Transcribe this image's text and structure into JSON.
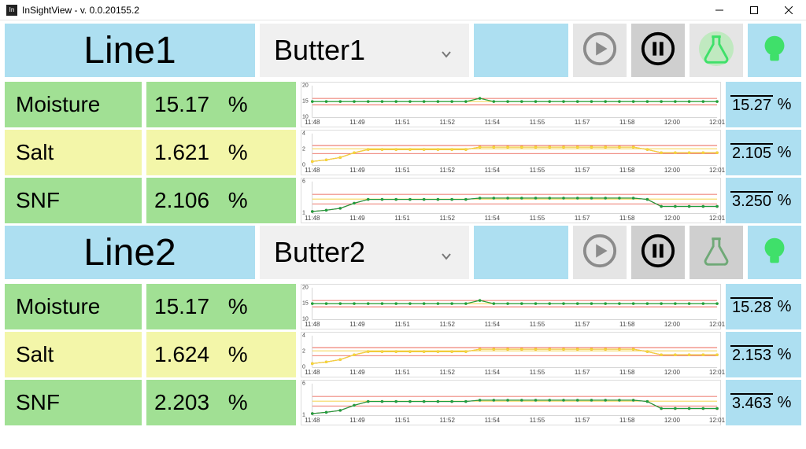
{
  "window": {
    "title": "InSightView - v. 0.0.20155.2",
    "icon_text": "In"
  },
  "lines": [
    {
      "title": "Line1",
      "recipe": "Butter1",
      "flask_glow": true,
      "params": [
        {
          "name": "Moisture",
          "value": "15.17",
          "unit": "%",
          "kind": "moist",
          "avg": "15.27",
          "chart": 0
        },
        {
          "name": "Salt",
          "value": "1.621",
          "unit": "%",
          "kind": "salt",
          "avg": "2.105",
          "chart": 1
        },
        {
          "name": "SNF",
          "value": "2.106",
          "unit": "%",
          "kind": "snf",
          "avg": "3.250",
          "chart": 2
        }
      ]
    },
    {
      "title": "Line2",
      "recipe": "Butter2",
      "flask_glow": false,
      "params": [
        {
          "name": "Moisture",
          "value": "15.17",
          "unit": "%",
          "kind": "moist",
          "avg": "15.28",
          "chart": 0
        },
        {
          "name": "Salt",
          "value": "1.624",
          "unit": "%",
          "kind": "salt",
          "avg": "2.153",
          "chart": 1
        },
        {
          "name": "SNF",
          "value": "2.203",
          "unit": "%",
          "kind": "snf",
          "avg": "3.463",
          "chart": 2
        }
      ]
    }
  ],
  "chart_data": [
    {
      "type": "line",
      "x_ticks": [
        "11:48",
        "11:49",
        "11:51",
        "11:52",
        "11:54",
        "11:55",
        "11:57",
        "11:58",
        "12:00",
        "12:01"
      ],
      "ylim": [
        10,
        20
      ],
      "y_ticks": [
        10,
        15,
        20
      ],
      "guides": {
        "red": [
          14,
          16
        ],
        "yellow": 15
      },
      "series": [
        {
          "name": "alt",
          "color": "#f4d93a",
          "values": [
            15,
            15,
            15,
            15,
            15,
            15,
            15,
            15,
            15,
            15,
            15,
            15,
            16,
            15,
            15,
            15,
            15,
            15,
            15,
            15,
            15,
            15,
            15,
            15,
            15,
            15,
            15,
            15,
            15,
            15
          ]
        },
        {
          "name": "main",
          "color": "#1e9e3e",
          "values": [
            15,
            15,
            15,
            15,
            15,
            15,
            15,
            15,
            15,
            15,
            15,
            15,
            16,
            15,
            15,
            15,
            15,
            15,
            15,
            15,
            15,
            15,
            15,
            15,
            15,
            15,
            15,
            15,
            15,
            15
          ]
        }
      ]
    },
    {
      "type": "line",
      "x_ticks": [
        "11:48",
        "11:49",
        "11:51",
        "11:52",
        "11:54",
        "11:55",
        "11:57",
        "11:58",
        "12:00",
        "12:01"
      ],
      "ylim": [
        0,
        4
      ],
      "y_ticks": [
        0,
        2,
        4
      ],
      "guides": {
        "red": [
          1.5,
          2.5
        ],
        "yellow": 2.1
      },
      "series": [
        {
          "name": "main",
          "color": "#d43f3a",
          "values": [
            0.5,
            0.7,
            1.0,
            1.6,
            2.0,
            2.0,
            2.0,
            2.0,
            2.0,
            2.0,
            2.0,
            2.0,
            2.3,
            2.3,
            2.3,
            2.3,
            2.3,
            2.3,
            2.3,
            2.3,
            2.3,
            2.3,
            2.3,
            2.3,
            2.0,
            1.6,
            1.6,
            1.6,
            1.6,
            1.6
          ]
        },
        {
          "name": "alt",
          "color": "#f4d93a",
          "values": [
            0.5,
            0.7,
            1.0,
            1.6,
            2.0,
            2.0,
            2.0,
            2.0,
            2.0,
            2.0,
            2.0,
            2.0,
            2.3,
            2.3,
            2.3,
            2.3,
            2.3,
            2.3,
            2.3,
            2.3,
            2.3,
            2.3,
            2.3,
            2.3,
            2.0,
            1.6,
            1.6,
            1.6,
            1.6,
            1.6
          ]
        }
      ]
    },
    {
      "type": "line",
      "x_ticks": [
        "11:48",
        "11:49",
        "11:51",
        "11:52",
        "11:54",
        "11:55",
        "11:57",
        "11:58",
        "12:00",
        "12:01"
      ],
      "ylim": [
        1,
        6
      ],
      "y_ticks": [
        1,
        6
      ],
      "guides": {
        "red": [
          2.5,
          4.0
        ],
        "yellow": 3.25
      },
      "series": [
        {
          "name": "alt",
          "color": "#d43f3a",
          "values": [
            1.3,
            1.5,
            1.8,
            2.6,
            3.2,
            3.2,
            3.2,
            3.2,
            3.2,
            3.2,
            3.2,
            3.2,
            3.4,
            3.4,
            3.4,
            3.4,
            3.4,
            3.4,
            3.4,
            3.4,
            3.4,
            3.4,
            3.4,
            3.4,
            3.2,
            2.1,
            2.1,
            2.1,
            2.1,
            2.1
          ]
        },
        {
          "name": "main",
          "color": "#1e9e3e",
          "values": [
            1.3,
            1.5,
            1.8,
            2.6,
            3.2,
            3.2,
            3.2,
            3.2,
            3.2,
            3.2,
            3.2,
            3.2,
            3.4,
            3.4,
            3.4,
            3.4,
            3.4,
            3.4,
            3.4,
            3.4,
            3.4,
            3.4,
            3.4,
            3.4,
            3.2,
            2.1,
            2.1,
            2.1,
            2.1,
            2.1
          ]
        }
      ]
    }
  ]
}
